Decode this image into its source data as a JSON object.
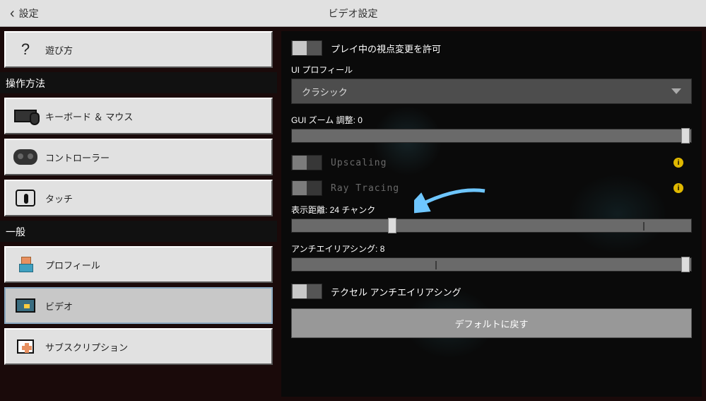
{
  "topbar": {
    "back_label": "設定",
    "title": "ビデオ設定"
  },
  "sidebar": {
    "how_to_play": "遊び方",
    "section_controls": "操作方法",
    "section_general": "一般",
    "items": {
      "keyboard_mouse": "キーボード ＆ マウス",
      "controller": "コントローラー",
      "touch": "タッチ",
      "profile": "プロフィール",
      "video": "ビデオ",
      "subscription": "サブスクリプション"
    }
  },
  "content": {
    "allow_view_change_label": "プレイ中の視点変更を許可",
    "ui_profile_label": "UI プロフィール",
    "ui_profile_value": "クラシック",
    "gui_zoom_label": "GUI ズーム 調整: 0",
    "upscaling_label": "Upscaling",
    "ray_tracing_label": "Ray Tracing",
    "render_distance_label": "表示距離: 24 チャンク",
    "antialiasing_label": "アンチエイリアシング: 8",
    "texel_aa_label": "テクセル アンチエイリアシング",
    "reset_label": "デフォルトに戻す",
    "info_glyph": "i"
  },
  "chart_data": {
    "type": "table",
    "title": "ビデオ設定 (Video Settings)",
    "rows": [
      {
        "setting": "プレイ中の視点変更を許可",
        "value": "off",
        "control": "toggle"
      },
      {
        "setting": "UI プロフィール",
        "value": "クラシック",
        "control": "dropdown"
      },
      {
        "setting": "GUI ズーム 調整",
        "value": 0,
        "control": "slider"
      },
      {
        "setting": "Upscaling",
        "value": "off",
        "enabled": false,
        "control": "toggle"
      },
      {
        "setting": "Ray Tracing",
        "value": "off",
        "enabled": false,
        "control": "toggle"
      },
      {
        "setting": "表示距離 (チャンク)",
        "value": 24,
        "control": "slider"
      },
      {
        "setting": "アンチエイリアシング",
        "value": 8,
        "control": "slider"
      },
      {
        "setting": "テクセル アンチエイリアシング",
        "value": "off",
        "control": "toggle"
      }
    ]
  }
}
